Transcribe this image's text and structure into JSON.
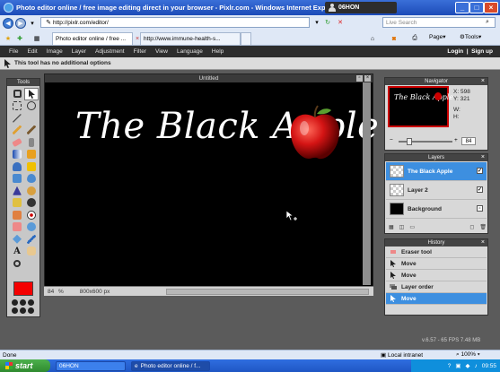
{
  "browser": {
    "title": "Photo editor online / free image editing direct in your browser - Pixlr.com - Windows Internet Explorer",
    "user": "06HON",
    "address": "http://pixlr.com/editor/",
    "search_placeholder": "Live Search",
    "tabs": [
      "Photo editor online / free ...",
      "http://www.immune-health-s..."
    ],
    "commands": {
      "page": "Page",
      "tools": "Tools"
    }
  },
  "pixlr": {
    "menu": [
      "File",
      "Edit",
      "Image",
      "Layer",
      "Adjustment",
      "Filter",
      "View",
      "Language",
      "Help"
    ],
    "login": "Login",
    "signup": "Sign up",
    "tool_options": "This tool has no additional options",
    "tools_title": "Tools",
    "canvas": {
      "title": "Untitled",
      "text": "The Black Apple",
      "zoom": "84",
      "zoom_unit": "%",
      "size": "800x600 px"
    },
    "navigator": {
      "title": "Navigator",
      "thumb_text": "The Black Apple",
      "x_label": "X:",
      "x": "598",
      "y_label": "Y:",
      "y": "321",
      "w_label": "W:",
      "h_label": "H:",
      "zoom": "84"
    },
    "layers": {
      "title": "Layers",
      "items": [
        {
          "name": "The Black Apple",
          "selected": true
        },
        {
          "name": "Layer 2",
          "selected": false
        },
        {
          "name": "Background",
          "selected": false
        }
      ]
    },
    "history": {
      "title": "History",
      "items": [
        {
          "name": "Eraser tool",
          "selected": false
        },
        {
          "name": "Move",
          "selected": false
        },
        {
          "name": "Move",
          "selected": false
        },
        {
          "name": "Layer order",
          "selected": false
        },
        {
          "name": "Move",
          "selected": true
        }
      ]
    },
    "fps": "v.6.57 - 65 FPS 7.48 MB",
    "foreground_color": "#f40000",
    "accent": "#3d8fe0"
  },
  "status": {
    "left": "Done",
    "zone": "Local intranet",
    "zoom": "100%"
  },
  "taskbar": {
    "start": "start",
    "tasks": [
      "06HON",
      "Photo editor online / f..."
    ],
    "clock": "09:55"
  }
}
